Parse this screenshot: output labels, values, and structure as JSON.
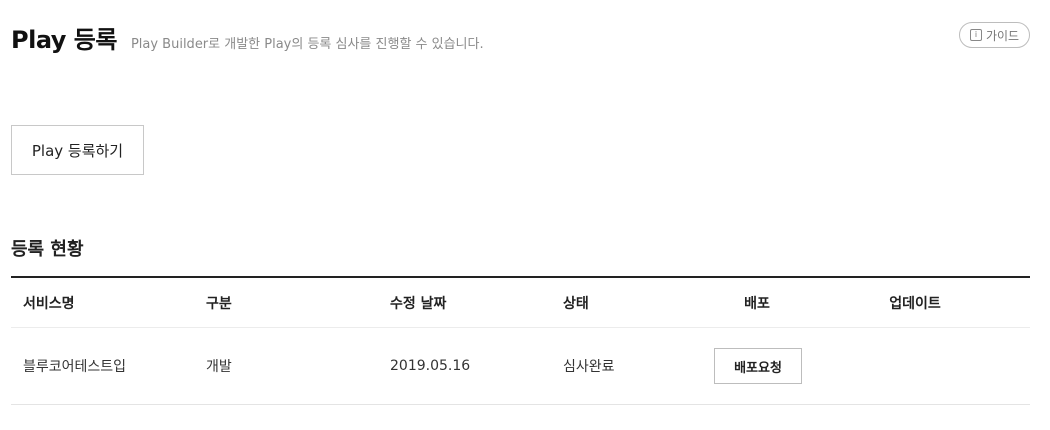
{
  "header": {
    "title": "Play 등록",
    "description": "Play Builder로 개발한 Play의 등록 심사를 진행할 수 있습니다.",
    "guide_label": "가이드"
  },
  "actions": {
    "register_label": "Play 등록하기"
  },
  "section": {
    "title": "등록 현황"
  },
  "table": {
    "columns": [
      "서비스명",
      "구분",
      "수정 날짜",
      "상태",
      "배포",
      "업데이트"
    ],
    "rows": [
      {
        "service_name": "블루코어테스트입",
        "category": "개발",
        "modified_date": "2019.05.16",
        "status": "심사완료",
        "deploy_label": "배포요청",
        "update": ""
      }
    ]
  },
  "icons": {
    "guide": "info-icon"
  }
}
